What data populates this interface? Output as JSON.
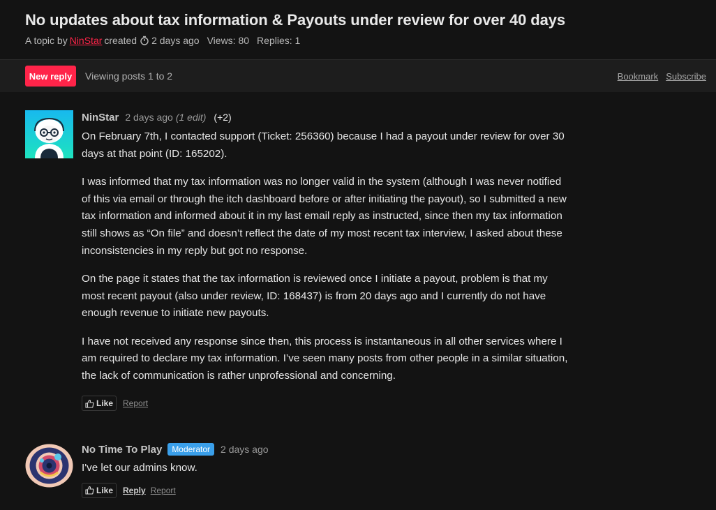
{
  "topic": {
    "title": "No updates about tax information & Payouts under review for over 40 days",
    "meta_prefix": "A topic by",
    "author": "NinStar",
    "created_label": "created",
    "created_time": "2 days ago",
    "views_label": "Views: 80",
    "replies_label": "Replies: 1"
  },
  "toolbar": {
    "new_reply_label": "New reply",
    "viewing_label": "Viewing posts 1 to 2",
    "bookmark_label": "Bookmark",
    "subscribe_label": "Subscribe",
    "accent_color": "#ff2449"
  },
  "posts": [
    {
      "author": "NinStar",
      "time": "2 days ago",
      "edit_note": "(1 edit)",
      "votes": "(+2)",
      "paragraphs": [
        "On February 7th, I contacted support (Ticket: 256360) because I had a payout under review for over 30 days at that point (ID: 165202).",
        "I was informed that my tax information was no longer valid in the system (although I was never notified of this via email or through the itch dashboard before or after initiating the payout), so I submitted a new tax information and informed about it in my last email reply as instructed, since then my tax information still shows as “On file” and doesn’t reflect the date of my most recent tax interview, I asked about these inconsistencies in my reply but got no response.",
        "On the page it states that the tax information is reviewed once I initiate a payout, problem is that my most recent payout (also under review, ID: 168437) is from 20 days ago and I currently do not have enough revenue to initiate new payouts.",
        "I have not received any response since then, this process is instantaneous in all other services where I am required to declare my tax information. I’ve seen many posts from other people in a similar situation, the lack of communication is rather unprofessional and concerning."
      ],
      "like_label": "Like",
      "report_label": "Report"
    },
    {
      "author": "No Time To Play",
      "badge": "Moderator",
      "time": "2 days ago",
      "paragraphs": [
        "I've let our admins know."
      ],
      "like_label": "Like",
      "reply_label": "Reply",
      "report_label": "Report"
    }
  ]
}
